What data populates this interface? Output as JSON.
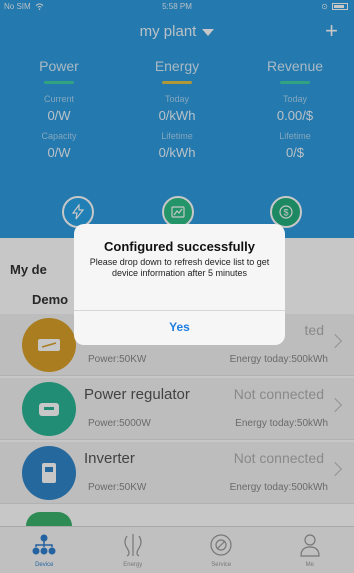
{
  "status_bar": {
    "carrier": "No SIM",
    "time": "5:58 PM"
  },
  "header": {
    "title": "my plant",
    "add_label": "+",
    "columns": [
      {
        "heading": "Power",
        "accent": "#3fd1a6",
        "row1_label": "Current",
        "row1_value": "0/W",
        "row2_label": "Capacity",
        "row2_value": "0/W"
      },
      {
        "heading": "Energy",
        "accent": "#e2c34a",
        "row1_label": "Today",
        "row1_value": "0/kWh",
        "row2_label": "Lifetime",
        "row2_value": "0/kWh"
      },
      {
        "heading": "Revenue",
        "accent": "#3fd1a6",
        "row1_label": "Today",
        "row1_value": "0.00/$",
        "row2_label": "Lifetime",
        "row2_value": "0/$"
      }
    ],
    "icons": [
      "lightning-icon",
      "chart-icon",
      "dollar-icon"
    ],
    "icon_colors": [
      "#2aa5e8",
      "#2fbf86",
      "#25b07e"
    ]
  },
  "devices": {
    "my_devices_label": "My de",
    "demo_label": "Demo",
    "items": [
      {
        "name": "",
        "status": "ted",
        "power": "Power:50KW",
        "energy": "Energy today:500kWh",
        "icon": "battery-icon",
        "color": "#d9a12a"
      },
      {
        "name": "Power regulator",
        "status": "Not connected",
        "power": "Power:5000W",
        "energy": "Energy today:50kWh",
        "icon": "regulator-icon",
        "color": "#2bb596"
      },
      {
        "name": "Inverter",
        "status": "Not connected",
        "power": "Power:50KW",
        "energy": "Energy today:500kWh",
        "icon": "inverter-icon",
        "color": "#2f86c9"
      }
    ]
  },
  "dialog": {
    "title": "Configured successfully",
    "message": "Please drop down  to refresh device list to get device information after 5 minutes",
    "confirm_label": "Yes"
  },
  "tabbar": {
    "tabs": [
      {
        "label": "Device",
        "icon": "device-icon",
        "active": true
      },
      {
        "label": "Energy",
        "icon": "energy-icon",
        "active": false
      },
      {
        "label": "Service",
        "icon": "service-icon",
        "active": false
      },
      {
        "label": "Me",
        "icon": "person-icon",
        "active": false
      }
    ]
  }
}
